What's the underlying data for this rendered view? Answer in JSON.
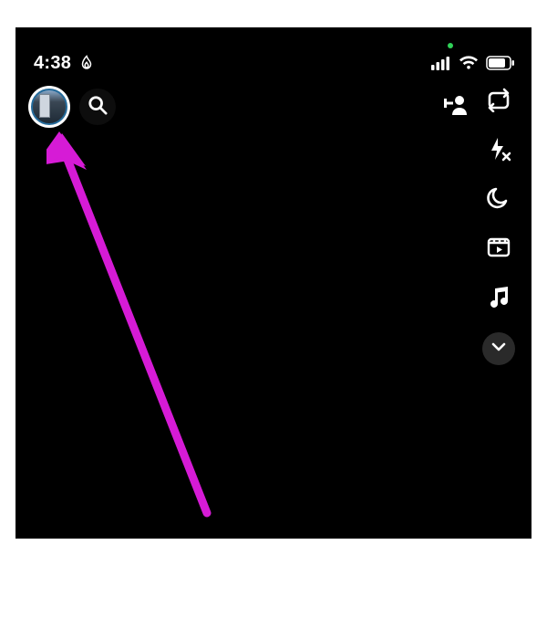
{
  "status_bar": {
    "time": "4:38",
    "icons": {
      "streak": "streak-icon",
      "privacy": "camera-privacy-dot",
      "cellular": "cellular-signal-icon",
      "wifi": "wifi-icon",
      "battery": "battery-icon"
    }
  },
  "top_bar": {
    "avatar": "profile-avatar",
    "search": "search",
    "add_friend": "add-friend"
  },
  "side_tools": {
    "items": [
      {
        "name": "flip-camera-icon"
      },
      {
        "name": "flash-off-icon"
      },
      {
        "name": "night-mode-icon"
      },
      {
        "name": "video-clip-icon"
      },
      {
        "name": "music-icon"
      }
    ],
    "expand": "expand-tools"
  },
  "annotation": {
    "arrow_color": "#d61bd6"
  }
}
